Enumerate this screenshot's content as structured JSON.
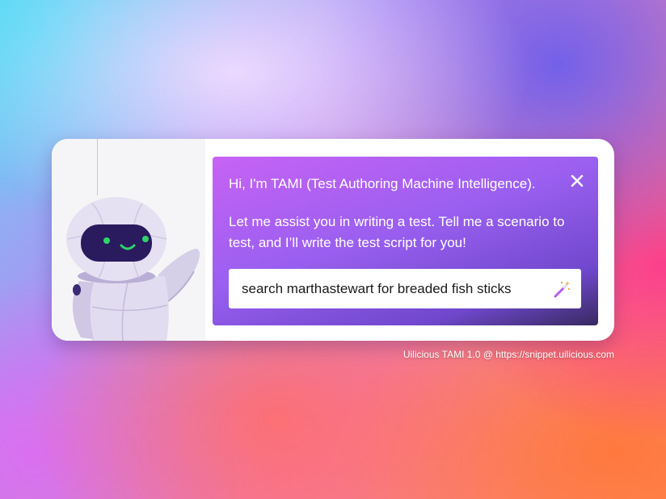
{
  "assistant": {
    "greeting": "Hi, I'm TAMI (Test Authoring Machine Intelligence).",
    "intro": "Let me assist you in writing a test. Tell me a scenario to test, and I’ll write the test script for you!",
    "input_value": "search marthastewart for breaded fish sticks",
    "close_icon": "close-icon",
    "submit_icon": "magic-wand-icon",
    "mascot_icon": "robot-mascot-icon"
  },
  "footer": {
    "credit": "Uilicious TAMI 1.0 @ https://snippet.uilicious.com"
  },
  "colors": {
    "panel_gradient_start": "#c763f5",
    "panel_gradient_end": "#37295f",
    "robot_eye": "#2fd46b",
    "robot_face": "#2a1a5e",
    "robot_body": "#ddd6ee"
  }
}
